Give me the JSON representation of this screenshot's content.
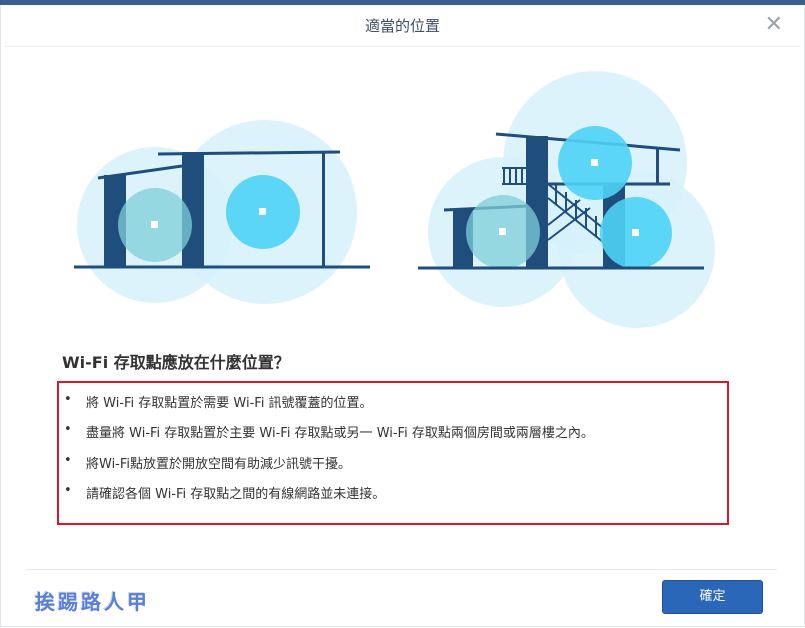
{
  "dialog": {
    "title": "適當的位置",
    "close_label": "✕"
  },
  "content": {
    "question": "Wi-Fi 存取點應放在什麼位置？",
    "bullet": "•",
    "tips": [
      "將 Wi-Fi 存取點置於需要 Wi-Fi 訊號覆蓋的位置。",
      "盡量將 Wi-Fi 存取點置於主要 Wi-Fi 存取點或另一 Wi-Fi 存取點兩個房間或兩層樓之內。",
      "將Wi-Fi點放置於開放空間有助減少訊號干擾。",
      "請確認各個 Wi-Fi 存取點之間的有線網路並未連接。"
    ]
  },
  "footer": {
    "watermark": "挨踢路人甲",
    "ok_label": "確定"
  },
  "colors": {
    "accent": "#2a67b9",
    "house": "#1f4e7c",
    "signal_light": "#c9eef9",
    "signal_mid": "#7fd8f2",
    "signal_strong": "#4dd3f5",
    "highlight_box": "#d9192a"
  }
}
